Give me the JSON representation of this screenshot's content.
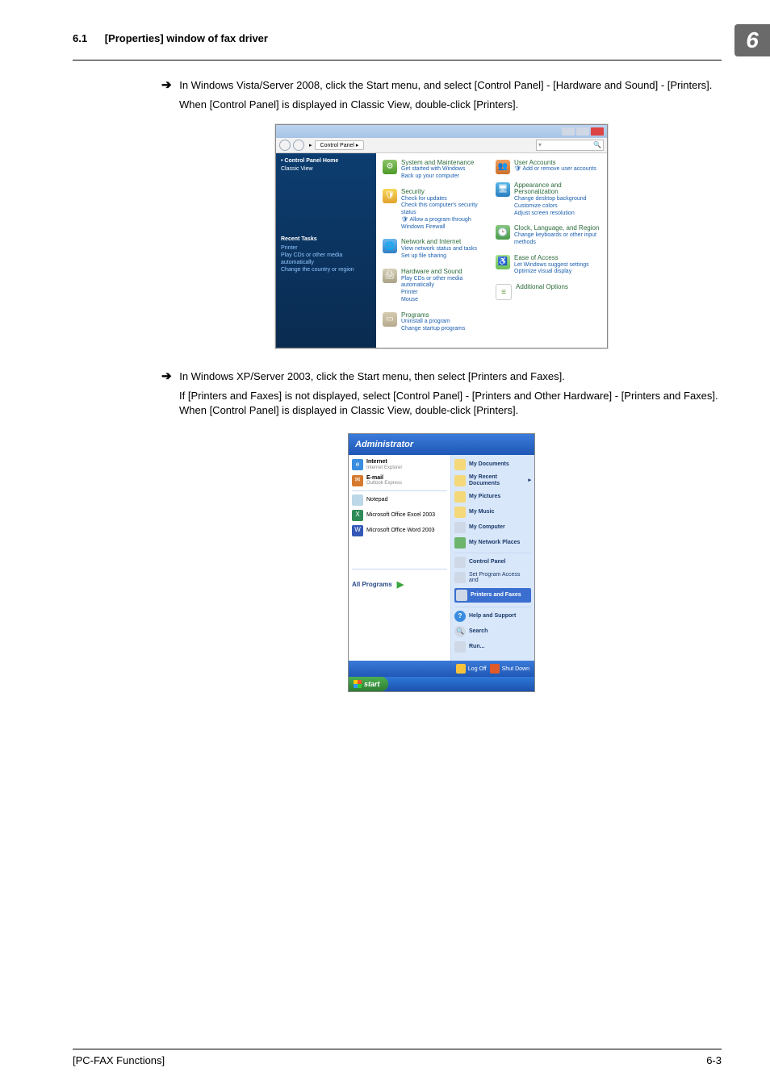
{
  "header": {
    "section_no": "6.1",
    "section_title": "[Properties] window of fax driver",
    "chapter_badge": "6"
  },
  "body": {
    "bullet1_line1": "In Windows Vista/Server 2008, click the Start menu, and select [Control Panel] - [Hardware and Sound] - [Printers].",
    "bullet1_line2": "When [Control Panel] is displayed in Classic View, double-click [Printers].",
    "bullet2_line1": "In Windows XP/Server 2003, click the Start menu, then select [Printers and Faxes].",
    "bullet2_line2": "If [Printers and Faxes] is not displayed, select [Control Panel] - [Printers and Other Hardware] - [Printers and Faxes]. When [Control Panel] is displayed in Classic View, double-click [Printers]."
  },
  "vista_cp": {
    "breadcrumb": "Control Panel",
    "sidebar": {
      "home": "Control Panel Home",
      "classic": "Classic View",
      "recent_title": "Recent Tasks",
      "recent_items": [
        "Printer",
        "Play CDs or other media automatically",
        "Change the country or region"
      ]
    },
    "left_col": [
      {
        "title": "System and Maintenance",
        "links": [
          "Get started with Windows",
          "Back up your computer"
        ]
      },
      {
        "title": "Security",
        "links": [
          "Check for updates",
          "Check this computer's security status",
          "Allow a program through Windows Firewall"
        ]
      },
      {
        "title": "Network and Internet",
        "links": [
          "View network status and tasks",
          "Set up file sharing"
        ]
      },
      {
        "title": "Hardware and Sound",
        "links": [
          "Play CDs or other media automatically",
          "Printer",
          "Mouse"
        ]
      },
      {
        "title": "Programs",
        "links": [
          "Uninstall a program",
          "Change startup programs"
        ]
      }
    ],
    "right_col": [
      {
        "title": "User Accounts",
        "links": [
          "Add or remove user accounts"
        ]
      },
      {
        "title": "Appearance and Personalization",
        "links": [
          "Change desktop background",
          "Customize colors",
          "Adjust screen resolution"
        ]
      },
      {
        "title": "Clock, Language, and Region",
        "links": [
          "Change keyboards or other input methods"
        ]
      },
      {
        "title": "Ease of Access",
        "links": [
          "Let Windows suggest settings",
          "Optimize visual display"
        ]
      },
      {
        "title": "Additional Options",
        "links": []
      }
    ]
  },
  "xp_menu": {
    "user": "Administrator",
    "left_pinned": [
      {
        "title": "Internet",
        "sub": "Internet Explorer"
      },
      {
        "title": "E-mail",
        "sub": "Outlook Express"
      }
    ],
    "left_recent": [
      "Notepad",
      "Microsoft Office Excel 2003",
      "Microsoft Office Word 2003"
    ],
    "all_programs": "All Programs",
    "right": [
      "My Documents",
      "My Recent Documents",
      "My Pictures",
      "My Music",
      "My Computer",
      "My Network Places"
    ],
    "right_mid": {
      "cp": "Control Panel",
      "spa": "Set Program Access and",
      "pf": "Printers and Faxes"
    },
    "right_bottom": [
      "Help and Support",
      "Search",
      "Run..."
    ],
    "logoff": "Log Off",
    "shutdown": "Shut Down",
    "start": "start"
  },
  "footer": {
    "left": "[PC-FAX Functions]",
    "right": "6-3"
  }
}
